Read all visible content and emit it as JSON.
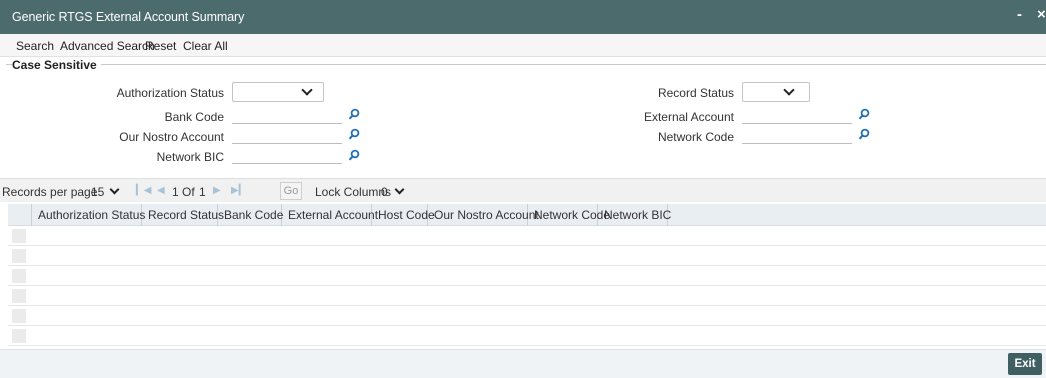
{
  "window": {
    "title": "Generic RTGS External Account Summary",
    "minimize_glyph": "-",
    "close_glyph": "×"
  },
  "menu": {
    "search": "Search",
    "advanced_search": "Advanced Search",
    "reset": "Reset",
    "clear_all": "Clear All"
  },
  "criteria": {
    "legend": "Case Sensitive",
    "authorization_status": {
      "label": "Authorization Status",
      "value": ""
    },
    "bank_code": {
      "label": "Bank Code",
      "value": ""
    },
    "our_nostro_account": {
      "label": "Our Nostro Account",
      "value": ""
    },
    "network_bic": {
      "label": "Network BIC",
      "value": ""
    },
    "record_status": {
      "label": "Record Status",
      "value": ""
    },
    "external_account": {
      "label": "External Account",
      "value": ""
    },
    "network_code": {
      "label": "Network Code",
      "value": ""
    }
  },
  "pager": {
    "records_per_page_label": "Records per page",
    "records_per_page_value": "15",
    "current_page": "1",
    "of_label": "Of",
    "total_pages": "1",
    "go_label": "Go",
    "lock_columns_label": "Lock Columns",
    "lock_columns_value": "0"
  },
  "grid": {
    "columns": [
      "Authorization Status",
      "Record Status",
      "Bank Code",
      "External Account",
      "Host Code",
      "Our Nostro Account",
      "Network Code",
      "Network BIC"
    ],
    "empty_rows": 6
  },
  "footer": {
    "exit_label": "Exit"
  },
  "colors": {
    "titlebar": "#4b6b6d",
    "accent_icon": "#1f6fb5",
    "exit_button": "#3f5f62"
  }
}
